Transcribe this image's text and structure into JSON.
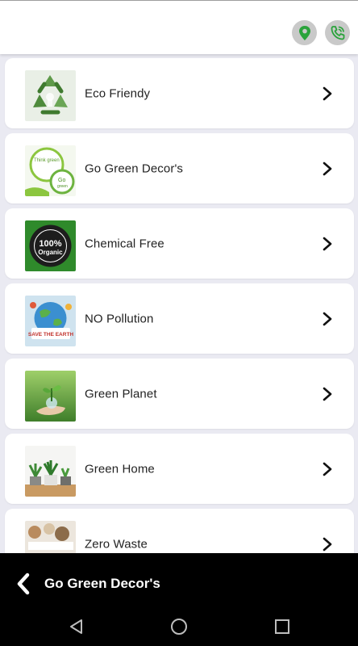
{
  "header": {
    "location_icon": "location-pin-icon",
    "call_icon": "phone-call-icon",
    "accent": "#2aa33b"
  },
  "items": [
    {
      "label": "Eco Friendy",
      "thumb": "recycle-image"
    },
    {
      "label": "Go Green Decor's",
      "thumb": "think-green-image",
      "thumb_text": [
        "Think green",
        "Go",
        "green"
      ]
    },
    {
      "label": "Chemical Free",
      "thumb": "organic-badge-image",
      "thumb_text": [
        "100%",
        "Organic"
      ]
    },
    {
      "label": "NO Pollution",
      "thumb": "save-earth-image",
      "thumb_text": [
        "SAVE THE EARTH"
      ]
    },
    {
      "label": "Green Planet",
      "thumb": "seedling-hand-image"
    },
    {
      "label": "Green Home",
      "thumb": "house-plants-image"
    },
    {
      "label": "Zero Waste",
      "thumb": "zero-waste-image"
    }
  ],
  "bottom_bar": {
    "title": "Go Green Decor's",
    "back_icon": "back-chevron-icon"
  },
  "system_nav": {
    "back": "nav-back-icon",
    "home": "nav-home-icon",
    "recents": "nav-recents-icon"
  }
}
